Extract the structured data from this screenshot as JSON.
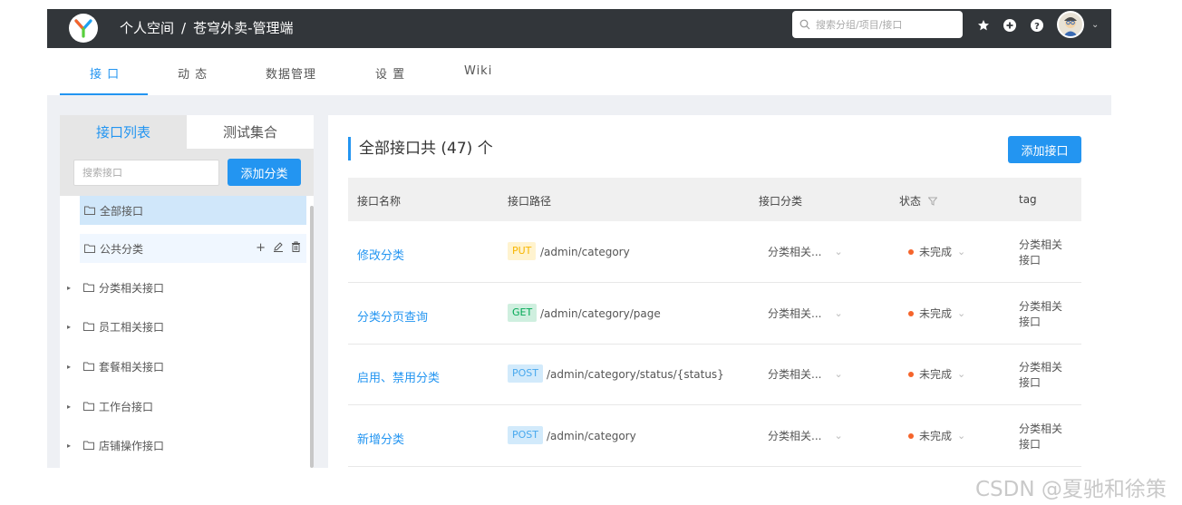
{
  "header": {
    "breadcrumb": [
      "个人空间",
      "/",
      "苍穹外卖-管理端"
    ],
    "search_placeholder": "搜索分组/项目/接口",
    "icons": [
      "star-icon",
      "plus-circle-icon",
      "help-icon",
      "avatar",
      "chevron-down-icon"
    ]
  },
  "nav": {
    "tabs": [
      {
        "label": "接 口",
        "active": true
      },
      {
        "label": "动 态",
        "active": false
      },
      {
        "label": "数据管理",
        "active": false
      },
      {
        "label": "设 置",
        "active": false
      },
      {
        "label": "Wiki",
        "active": false
      }
    ]
  },
  "left": {
    "tabs": [
      {
        "label": "接口列表",
        "active": true
      },
      {
        "label": "测试集合",
        "active": false
      }
    ],
    "search_placeholder": "搜索接口",
    "add_category_label": "添加分类",
    "tree": [
      {
        "label": "全部接口",
        "selected": true
      },
      {
        "label": "公共分类",
        "hovered": true
      },
      {
        "label": "分类相关接口"
      },
      {
        "label": "员工相关接口"
      },
      {
        "label": "套餐相关接口"
      },
      {
        "label": "工作台接口"
      },
      {
        "label": "店铺操作接口"
      }
    ]
  },
  "main": {
    "title": "全部接口共 (47) 个",
    "add_api_label": "添加接口",
    "columns": [
      "接口名称",
      "接口路径",
      "接口分类",
      "状态",
      "tag"
    ],
    "rows": [
      {
        "name": "修改分类",
        "method": "PUT",
        "path": "/admin/category",
        "category": "分类相关...",
        "status": "未完成",
        "tag": "分类相关接口"
      },
      {
        "name": "分类分页查询",
        "method": "GET",
        "path": "/admin/category/page",
        "category": "分类相关...",
        "status": "未完成",
        "tag": "分类相关接口"
      },
      {
        "name": "启用、禁用分类",
        "method": "POST",
        "path": "/admin/category/status/{status}",
        "category": "分类相关...",
        "status": "未完成",
        "tag": "分类相关接口"
      },
      {
        "name": "新增分类",
        "method": "POST",
        "path": "/admin/category",
        "category": "分类相关...",
        "status": "未完成",
        "tag": "分类相关接口"
      }
    ]
  },
  "colors": {
    "primary": "#2395f1",
    "header_bg": "#32363a",
    "status_dot": "#f5642b",
    "put": "#f7b500",
    "get": "#00a854",
    "post": "#49a9ee"
  },
  "watermark": "CSDN @夏驰和徐策"
}
